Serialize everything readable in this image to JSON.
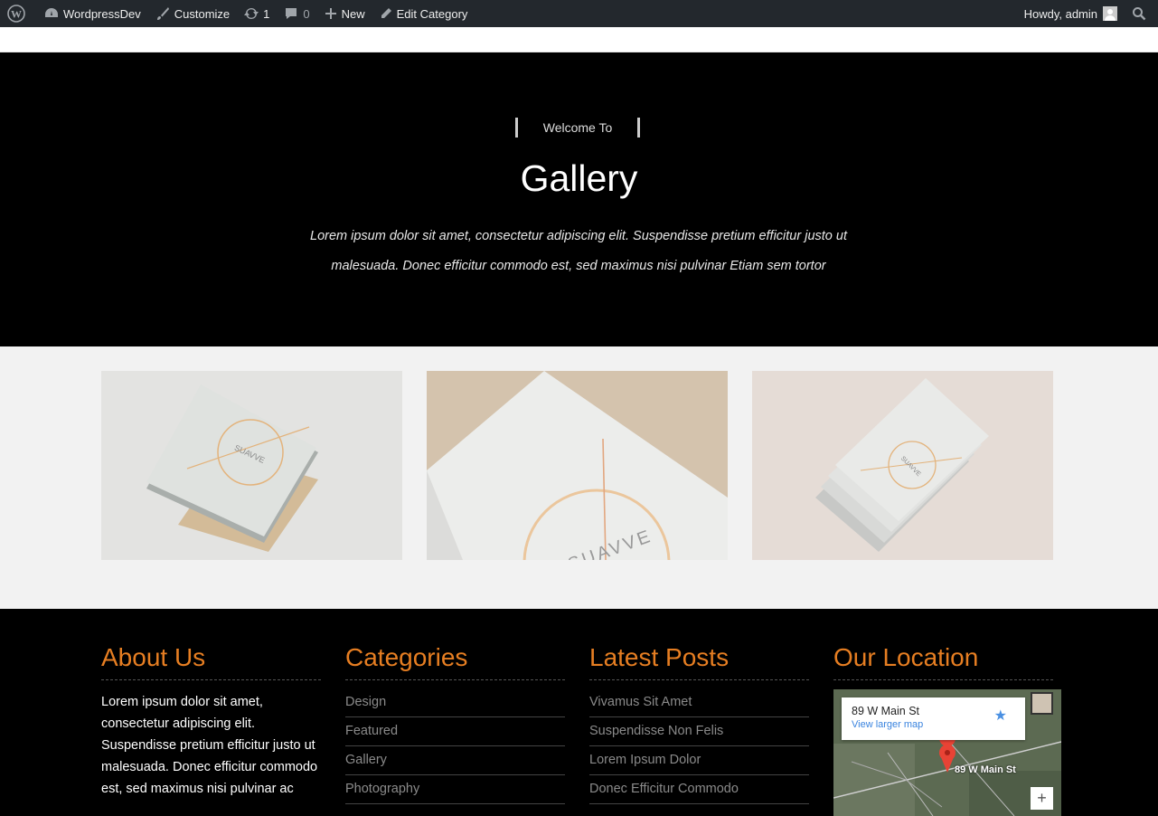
{
  "adminbar": {
    "site": "WordpressDev",
    "customize": "Customize",
    "updates": "1",
    "comments": "0",
    "new": "New",
    "edit": "Edit Category",
    "howdy": "Howdy, admin"
  },
  "hero": {
    "welcome": "Welcome To",
    "title": "Gallery",
    "desc": "Lorem ipsum dolor sit amet, consectetur adipiscing elit. Suspendisse pretium efficitur justo ut malesuada. Donec efficitur commodo est, sed maximus nisi pulvinar Etiam sem tortor"
  },
  "gallery": {
    "brand_text": "SUAVVE"
  },
  "footer": {
    "about": {
      "heading": "About Us",
      "text": "Lorem ipsum dolor sit amet, consectetur adipiscing elit. Suspendisse pretium efficitur justo ut malesuada. Donec efficitur commodo est, sed maximus nisi pulvinar ac"
    },
    "categories": {
      "heading": "Categories",
      "items": [
        "Design",
        "Featured",
        "Gallery",
        "Photography"
      ]
    },
    "latest": {
      "heading": "Latest Posts",
      "items": [
        "Vivamus Sit Amet",
        "Suspendisse Non Felis",
        "Lorem Ipsum Dolor",
        "Donec Efficitur Commodo"
      ]
    },
    "location": {
      "heading": "Our Location",
      "address": "89 W Main St",
      "link": "View larger map",
      "pin_label": "89 W Main St",
      "zoom_in": "+"
    }
  },
  "colors": {
    "accent": "#e67e22",
    "adminbar": "#23282d"
  }
}
